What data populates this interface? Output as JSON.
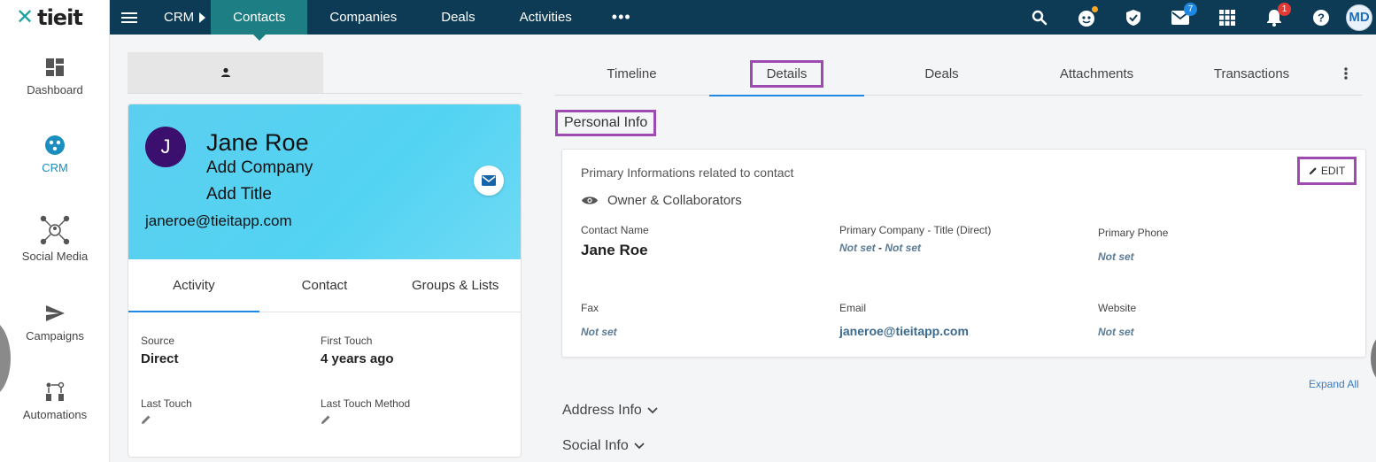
{
  "brand": {
    "logo_text": "tieit"
  },
  "rail": {
    "items": [
      {
        "label": "Dashboard",
        "icon": "dashboard-icon"
      },
      {
        "label": "CRM",
        "icon": "crm-icon",
        "active": true
      },
      {
        "label": "Social Media",
        "icon": "social-media-icon"
      },
      {
        "label": "Campaigns",
        "icon": "send-icon"
      },
      {
        "label": "Automations",
        "icon": "automation-icon"
      }
    ]
  },
  "topbar": {
    "breadcrumb": "CRM",
    "tabs": [
      "Contacts",
      "Companies",
      "Deals",
      "Activities"
    ],
    "more": "•••",
    "mail_badge": "7",
    "notification_badge": "1",
    "user_initials": "MD"
  },
  "contact": {
    "initial": "J",
    "name": "Jane Roe",
    "company": "Add Company",
    "title": "Add Title",
    "email": "janeroe@tieitapp.com",
    "tabs": [
      "Activity",
      "Contact",
      "Groups & Lists"
    ],
    "source_label": "Source",
    "source_value": "Direct",
    "first_touch_label": "First Touch",
    "first_touch_value": "4 years ago",
    "last_touch_label": "Last Touch",
    "last_touch_method_label": "Last Touch Method"
  },
  "details": {
    "tabs": [
      "Timeline",
      "Details",
      "Deals",
      "Attachments",
      "Transactions"
    ],
    "section_title": "Personal Info",
    "subtitle": "Primary Informations related to contact",
    "owner_label": "Owner & Collaborators",
    "edit_label": "EDIT",
    "fields": {
      "contact_name_label": "Contact Name",
      "contact_name_value": "Jane Roe",
      "primary_company_label": "Primary Company - Title (Direct)",
      "primary_company_value": "Not set",
      "primary_company_sep": " - ",
      "primary_title_value": "Not set",
      "primary_phone_label": "Primary Phone",
      "primary_phone_value": "Not set",
      "fax_label": "Fax",
      "fax_value": "Not set",
      "email_label": "Email",
      "email_value": "janeroe@tieitapp.com",
      "website_label": "Website",
      "website_value": "Not set"
    },
    "expand_all": "Expand All",
    "address_info": "Address Info",
    "social_info": "Social Info"
  },
  "colors": {
    "topbar": "#0d3b55",
    "active_tab": "#1d7f83",
    "highlight": "#9d4bb0",
    "hero": "#5ccff0",
    "accent": "#1e88e5"
  }
}
